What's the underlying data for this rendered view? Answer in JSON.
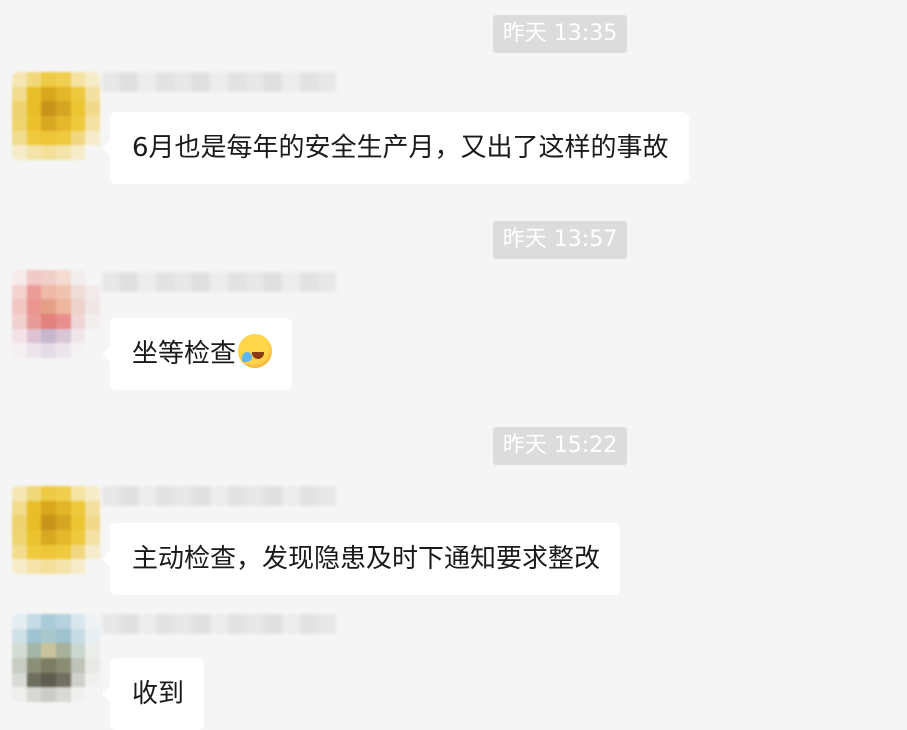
{
  "messages": [
    {
      "time": "昨天 13:35",
      "text": "6月也是每年的安全生产月，又出了这样的事故"
    },
    {
      "time": "昨天 13:57",
      "text": "坐等检查",
      "emoji": "face-with-tears-of-joy-emoji"
    },
    {
      "time": "昨天 15:22",
      "text": "主动检查，发现隐患及时下通知要求整改"
    },
    {
      "text": "收到"
    }
  ],
  "colors": {
    "background": "#f5f5f5",
    "bubble": "#ffffff",
    "timestamp_bg": "#dcdcdc",
    "timestamp_text": "#ffffff"
  }
}
